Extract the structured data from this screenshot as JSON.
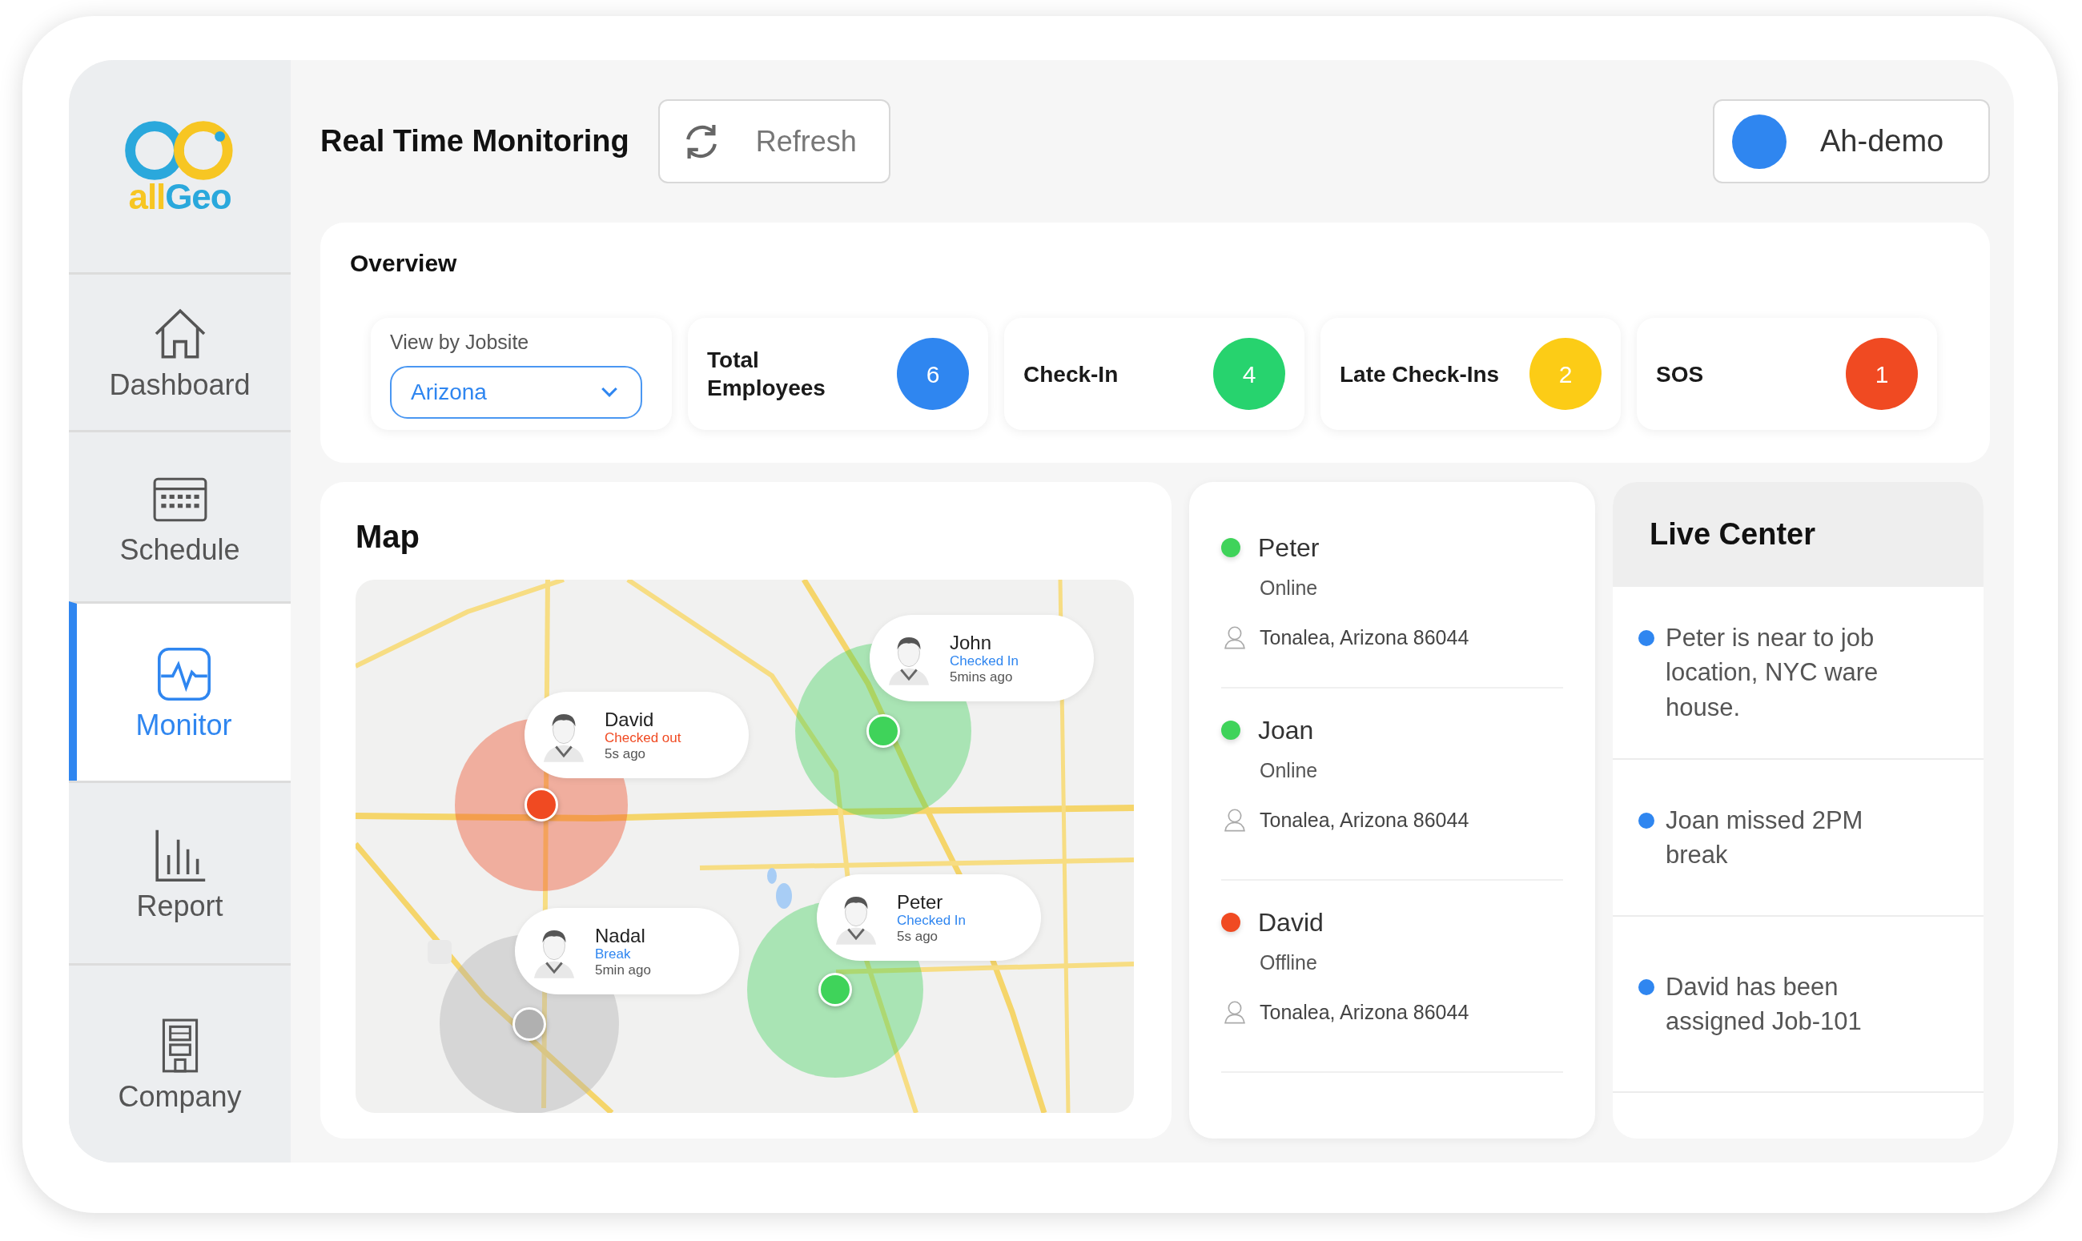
{
  "logo": {
    "text": [
      "all",
      "Geo"
    ]
  },
  "sidebar": {
    "items": [
      {
        "label": "Dashboard",
        "selected": false
      },
      {
        "label": "Schedule",
        "selected": false
      },
      {
        "label": "Monitor",
        "selected": true
      },
      {
        "label": "Report",
        "selected": false
      },
      {
        "label": "Company",
        "selected": false
      }
    ]
  },
  "header": {
    "title": "Real Time Monitoring",
    "refresh_button": "Refresh",
    "user": "Ah-demo"
  },
  "overview": {
    "title": "Overview",
    "jobsite": {
      "label": "View by Jobsite",
      "value": "Arizona"
    },
    "stats": [
      {
        "label": "Total Employees",
        "value": "6",
        "color": "#2f86f0"
      },
      {
        "label": "Check-In",
        "value": "4",
        "color": "#27d36e"
      },
      {
        "label": "Late Check-Ins",
        "value": "2",
        "color": "#fccc16"
      },
      {
        "label": "SOS",
        "value": "1",
        "color": "#f04a22"
      }
    ]
  },
  "map": {
    "title": "Map",
    "markers": [
      {
        "name": "David",
        "status": "Checked out",
        "kind": "out",
        "time": "5s ago",
        "color": "#f04a22"
      },
      {
        "name": "John",
        "status": "Checked In",
        "kind": "in",
        "time": "5mins ago",
        "color": "#3fd35a"
      },
      {
        "name": "Nadal",
        "status": "Break",
        "kind": "break",
        "time": "5min ago",
        "color": "#b0b0b0"
      },
      {
        "name": "Peter",
        "status": "Checked In",
        "kind": "in",
        "time": "5s ago",
        "color": "#3fd35a"
      }
    ]
  },
  "people": [
    {
      "name": "Peter",
      "status": "Online",
      "location": "Tonalea, Arizona 86044",
      "color": "#3fd35a"
    },
    {
      "name": "Joan",
      "status": "Online",
      "location": "Tonalea, Arizona 86044",
      "color": "#3fd35a"
    },
    {
      "name": "David",
      "status": "Offline",
      "location": "Tonalea, Arizona 86044",
      "color": "#f04a22"
    }
  ],
  "live_center": {
    "title": "Live Center",
    "items": [
      "Peter is near to job location, NYC ware house.",
      "Joan missed 2PM break",
      "David has been assigned Job-101"
    ]
  }
}
